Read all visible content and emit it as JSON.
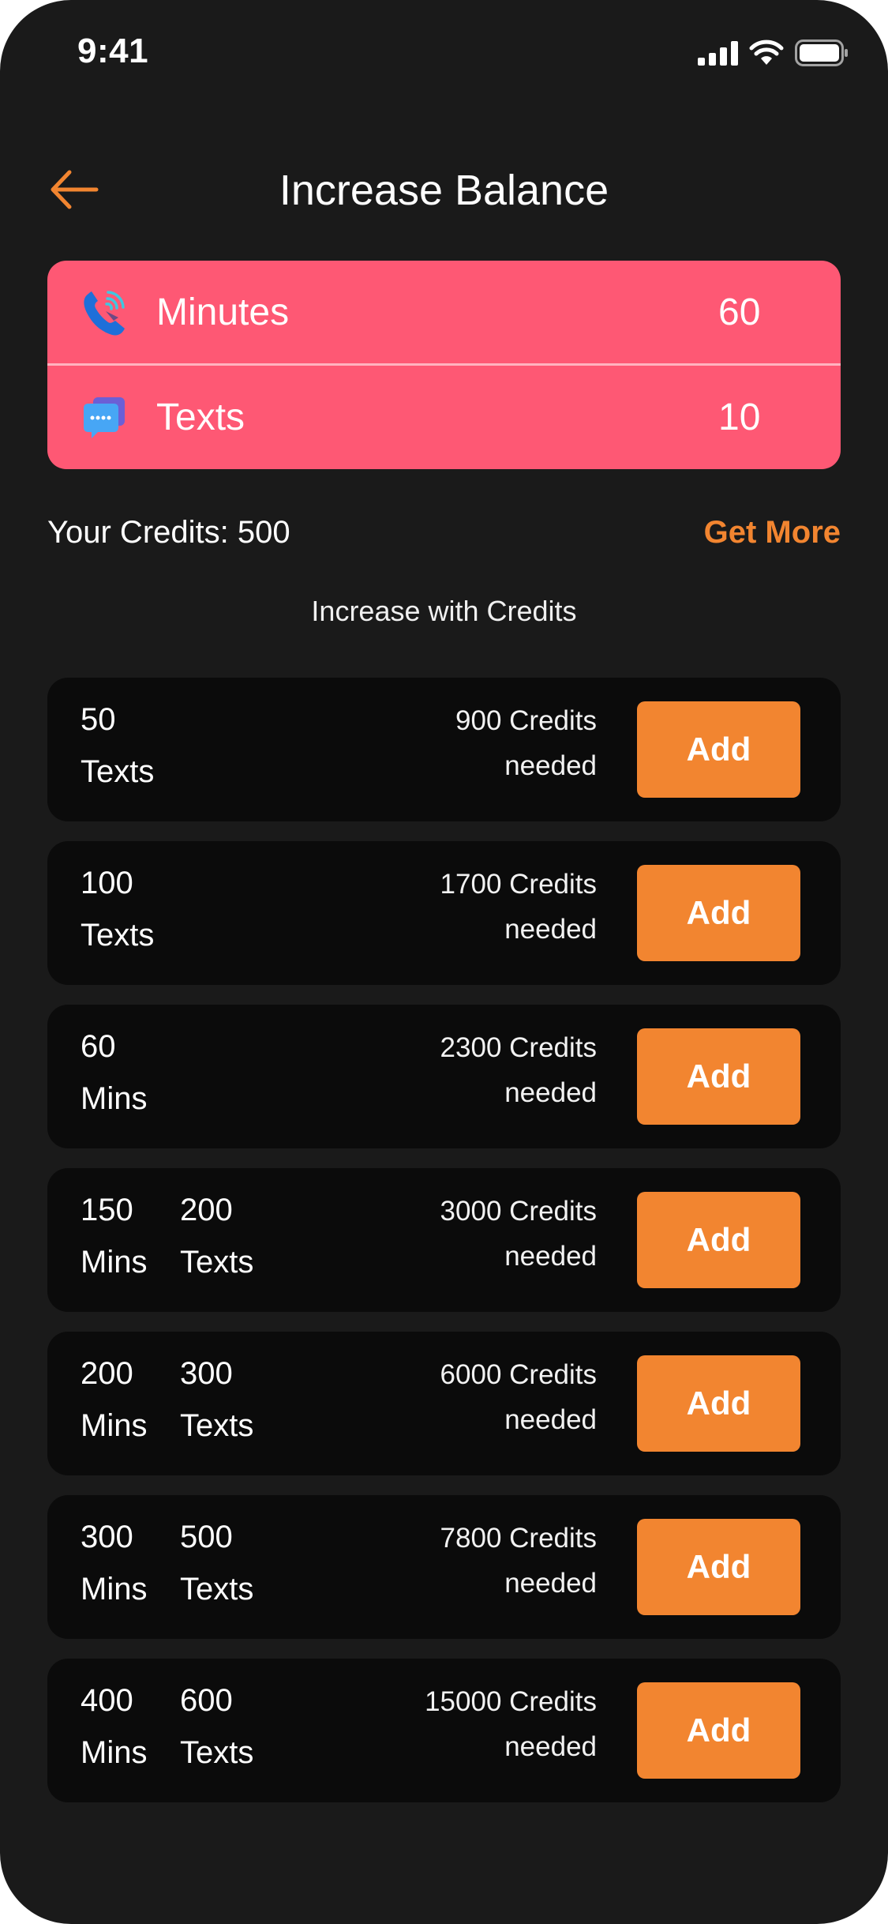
{
  "status_bar": {
    "time": "9:41"
  },
  "header": {
    "title": "Increase Balance",
    "back_icon": "arrow-left-icon"
  },
  "balance": {
    "minutes": {
      "label": "Minutes",
      "value": "60",
      "icon": "phone-call-icon"
    },
    "texts": {
      "label": "Texts",
      "value": "10",
      "icon": "chat-bubble-icon"
    }
  },
  "credits": {
    "text": "Your Credits: 500",
    "get_more": "Get More"
  },
  "section_caption": "Increase with Credits",
  "packages": [
    {
      "a_num": "50",
      "a_unit": "Texts",
      "b_num": "",
      "b_unit": "",
      "cost": "900 Credits",
      "cost_suffix": "needed",
      "button": "Add"
    },
    {
      "a_num": "100",
      "a_unit": "Texts",
      "b_num": "",
      "b_unit": "",
      "cost": "1700 Credits",
      "cost_suffix": "needed",
      "button": "Add"
    },
    {
      "a_num": "60",
      "a_unit": "Mins",
      "b_num": "",
      "b_unit": "",
      "cost": "2300 Credits",
      "cost_suffix": "needed",
      "button": "Add"
    },
    {
      "a_num": "150",
      "a_unit": "Mins",
      "b_num": "200",
      "b_unit": "Texts",
      "cost": "3000 Credits",
      "cost_suffix": "needed",
      "button": "Add"
    },
    {
      "a_num": "200",
      "a_unit": "Mins",
      "b_num": "300",
      "b_unit": "Texts",
      "cost": "6000 Credits",
      "cost_suffix": "needed",
      "button": "Add"
    },
    {
      "a_num": "300",
      "a_unit": "Mins",
      "b_num": "500",
      "b_unit": "Texts",
      "cost": "7800 Credits",
      "cost_suffix": "needed",
      "button": "Add"
    },
    {
      "a_num": "400",
      "a_unit": "Mins",
      "b_num": "600",
      "b_unit": "Texts",
      "cost": "15000 Credits",
      "cost_suffix": "needed",
      "button": "Add"
    }
  ],
  "colors": {
    "background": "#1a1a1a",
    "card": "#0b0b0b",
    "balance_card": "#fe5874",
    "accent": "#f28530"
  }
}
